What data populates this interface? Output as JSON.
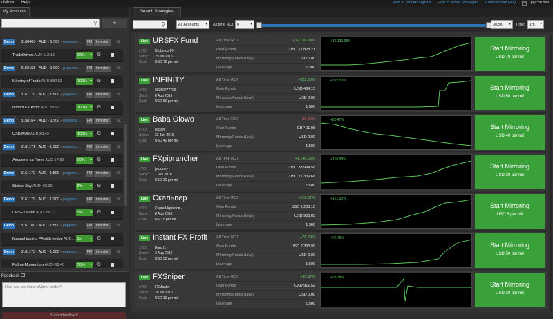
{
  "menu": {
    "app": "cMirror",
    "help": "Help"
  },
  "links": {
    "proven": "How to Proven Signals",
    "mirror": "How to Mirror Strategies",
    "community": "Commentors FAQ",
    "user": "jaycob.bell"
  },
  "left": {
    "tab": "My Accounts",
    "plus": "+",
    "rows": [
      {
        "kind": "acc",
        "demo": "Demo",
        "acc": "3160463 - AUD - 1:500 -",
        "link": "pepperst...",
        "sl": "SL"
      },
      {
        "kind": "sub",
        "name": "TradeDriven",
        "val": "AUD 112.18",
        "pct": "30%",
        "fm": "FM",
        "inv": "Investor"
      },
      {
        "kind": "acc",
        "demo": "Demo",
        "acc": "3158155 - AUD - 1:500 -",
        "link": "pepperst...",
        "sl": "SL"
      },
      {
        "kind": "sub",
        "name": "Ministry of Trade",
        "val": "AUD 882.53",
        "pct": "100%",
        "fm": "FM",
        "inv": "Investor"
      },
      {
        "kind": "acc",
        "demo": "Demo",
        "acc": "3161170 - AUD - 1:500 -",
        "link": "pepperst...",
        "sl": "SL"
      },
      {
        "kind": "sub",
        "name": "Instant FX Profit",
        "val": "AUD 89.91",
        "pct": "100%",
        "fm": "FM",
        "inv": "Investor"
      },
      {
        "kind": "acc",
        "demo": "Demo",
        "acc": "3158164 - AUD - 1:500 -",
        "link": "pepperst...",
        "sl": "SL"
      },
      {
        "kind": "sub",
        "name": "USD/RUB",
        "val": "AUD 28.49",
        "pct": "100%",
        "fm": "FM",
        "inv": "Investor"
      },
      {
        "kind": "acc",
        "demo": "Demo",
        "acc": "3161171 - AUD - 1:500 -",
        "link": "pepperst...",
        "sl": "SL"
      },
      {
        "kind": "sub",
        "name": "Amazona sa Forex",
        "val": "AUD 57.82",
        "pct": "90%",
        "fm": "FM",
        "inv": "Investor"
      },
      {
        "kind": "acc",
        "demo": "Demo",
        "acc": "3161172 - AUD - 1:500 -",
        "link": "pepperst...",
        "sl": "SL"
      },
      {
        "kind": "sub",
        "name": "Stokes Bay",
        "val": "AUD -58.26",
        "pct": "5%",
        "fm": "FM",
        "inv": "Investor"
      },
      {
        "kind": "acc",
        "demo": "Demo",
        "acc": "3161179 - AUD - 1:200 -",
        "link": "pepperst...",
        "sl": "SL"
      },
      {
        "kind": "sub",
        "name": "URSFX Fund",
        "val": "AUD -58.27",
        "pct": "5%",
        "fm": "FM",
        "inv": "Investor"
      },
      {
        "kind": "acc",
        "demo": "Demo",
        "acc": "3161180 - AUD - 1:500 -",
        "link": "pepperst...",
        "sl": "SL"
      },
      {
        "kind": "sub",
        "name": "Manual trading PA with hedge",
        "val": "AUD...",
        "pct": "2x",
        "fm": "FM",
        "inv": "Investor"
      },
      {
        "kind": "acc",
        "demo": "Demo",
        "acc": "3161173 - AUD - 1:500 -",
        "link": "pepperst...",
        "sl": "SL"
      },
      {
        "kind": "sub",
        "name": "Follow-Momentum",
        "val": "AUD -12.40",
        "pct": "50%",
        "fm": "FM",
        "inv": "Investor"
      }
    ],
    "feedback": {
      "title": "Feedback",
      "placeholder": "How can we make cMirror better?",
      "submit": "Submit feedback"
    }
  },
  "right": {
    "tab": "Search Strategies",
    "filters": {
      "accounts": "All Accounts",
      "roi_label": "All time ROI:",
      "roi_min": "0",
      "roi_max": "30200",
      "time_label": "Time:",
      "time": "1m"
    },
    "labels": {
      "ctid": "cTID:",
      "since": "Since:",
      "cost": "Cost:",
      "alltime": "All Time ROI",
      "own": "Own Funds",
      "mirroring": "Mirroring Funds (Live)",
      "leverage": "Leverage",
      "start": "Start Mirroring"
    },
    "strategies": [
      {
        "name": "URSFX Fund",
        "live": "Live",
        "ctid": "Uroboros FX ·",
        "since": "29 Jul 2016",
        "cost": "USD 70 per mil",
        "roi": "+12 130.98%",
        "own": "USD 12 828.21",
        "mirroring": "USD 0.00",
        "leverage": "1:300",
        "chart_roi": "+12 130.98%",
        "btn_sub": "USD 70 per mil",
        "roi_sign": "pos"
      },
      {
        "name": "INFINITY",
        "live": "Live",
        "ctid": "89250777706 ·",
        "since": "8 Aug 2016",
        "cost": "USD 50 per mil",
        "roi": "+322.50%",
        "own": "USD 484.15",
        "mirroring": "USD 0.00",
        "leverage": "1:500",
        "chart_roi": "+322.50%",
        "btn_sub": "USD 50 per mil",
        "roi_sign": "pos"
      },
      {
        "name": "Baba Olowo",
        "live": "Live",
        "ctid": "lekssh ·",
        "since": "23 Jun 2016",
        "cost": "USD 40 per mil",
        "roi": "-96.65%",
        "own": "GBP 11.98",
        "mirroring": "USD 0.00",
        "leverage": "1:500",
        "chart_roi": "+88.47%",
        "btn_sub": "USD 40 per mil",
        "roi_sign": "neg"
      },
      {
        "name": "FXpiprancher",
        "live": "Live",
        "ctid": "jsrodney ·",
        "since": "1 Jun 2016",
        "cost": "USD 30 per mil",
        "roi": "+1 146.62%",
        "own": "USD 33 994.58",
        "mirroring": "USD 21 339.68",
        "leverage": "1:500",
        "chart_roi": "+169.98%",
        "btn_sub": "USD 30 per mil",
        "roi_sign": "pos"
      },
      {
        "name": "Скальпер",
        "live": "Live",
        "ctid": "Сергей Кутепов ·",
        "since": "8 Aug 2016",
        "cost": "USD 5 per mil",
        "roi": "+216.67%",
        "own": "USD 1 203.15",
        "mirroring": "USD 933.65",
        "leverage": "1:300",
        "chart_roi": "+121.53%",
        "btn_sub": "USD 5 per mil",
        "roi_sign": "pos"
      },
      {
        "name": "Instant FX Profit",
        "live": "Live",
        "ctid": "Euro fx ·",
        "since": "3 Aug 2016",
        "cost": "USD 50 per mil",
        "roi": "+76.79%",
        "own": "USD 2 393.99",
        "mirroring": "USD 0.00",
        "leverage": "1:500",
        "chart_roi": "+76.79%",
        "btn_sub": "USD 50 per mil",
        "roi_sign": "pos"
      },
      {
        "name": "FXSniper",
        "live": "Live",
        "ctid": "FXMaster ·",
        "since": "28 Jul 2016",
        "cost": "USD 30 per mil",
        "roi": "+35.97%",
        "own": "CAD 912.52",
        "mirroring": "USD 0.00",
        "leverage": "1:500",
        "chart_roi": "+28.38%",
        "btn_sub": "USD 30 per mil",
        "roi_sign": "pos"
      }
    ]
  },
  "colors": {
    "accent_green": "#3aa13a",
    "demo_blue": "#2a73b8",
    "line": "#5cc55c"
  }
}
